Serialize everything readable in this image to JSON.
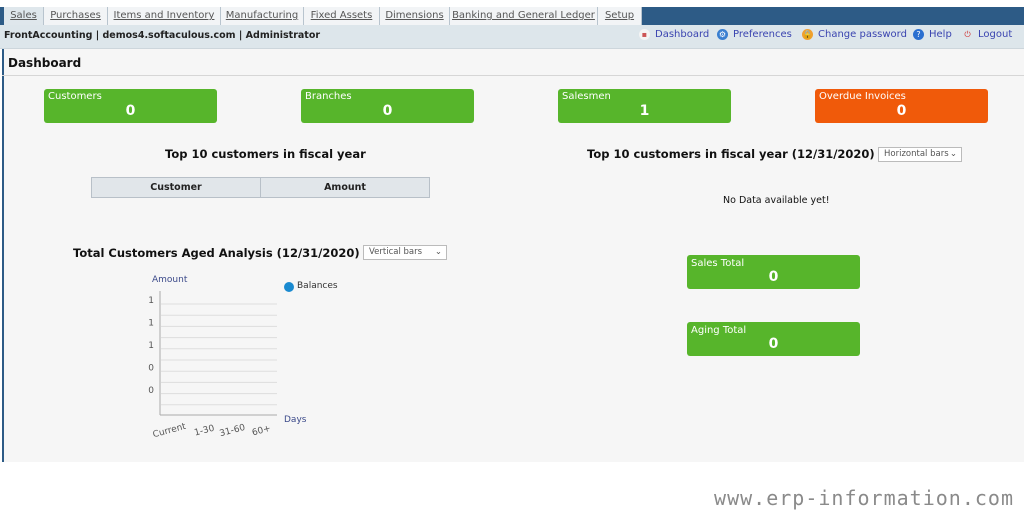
{
  "tabs": [
    "Sales",
    "Purchases",
    "Items and Inventory",
    "Manufacturing",
    "Fixed Assets",
    "Dimensions",
    "Banking and General Ledger",
    "Setup"
  ],
  "header": {
    "brand": "FrontAccounting | demos4.softaculous.com | Administrator",
    "links": [
      {
        "label": "Dashboard",
        "icon": "dashboard-icon"
      },
      {
        "label": "Preferences",
        "icon": "gear-icon"
      },
      {
        "label": "Change password",
        "icon": "lock-icon"
      },
      {
        "label": "Help",
        "icon": "help-icon"
      },
      {
        "label": "Logout",
        "icon": "power-icon"
      }
    ]
  },
  "page_title": "Dashboard",
  "cards": [
    {
      "label": "Customers",
      "value": "0"
    },
    {
      "label": "Branches",
      "value": "0"
    },
    {
      "label": "Salesmen",
      "value": "1"
    },
    {
      "label": "Overdue Invoices",
      "value": "0"
    }
  ],
  "top10_left": {
    "title": "Top 10 customers in fiscal year",
    "columns": [
      "Customer",
      "Amount"
    ]
  },
  "top10_right": {
    "title": "Top 10 customers in fiscal year (12/31/2020)",
    "select": "Horizontal bars",
    "empty": "No Data available yet!"
  },
  "aged": {
    "title": "Total Customers Aged Analysis (12/31/2020)",
    "select": "Vertical bars"
  },
  "totals": [
    {
      "label": "Sales Total",
      "value": "0"
    },
    {
      "label": "Aging Total",
      "value": "0"
    }
  ],
  "colors": {
    "green": "#57b52b",
    "orange": "#f05a0a",
    "nav_blue": "#2d5b86",
    "legend": "#1a8ad0"
  },
  "chart_data": {
    "type": "bar",
    "ylabel": "Amount",
    "xlabel": "Days",
    "categories": [
      "Current",
      "1-30",
      "31-60",
      "60+"
    ],
    "yticks": [
      "1",
      "1",
      "1",
      "0",
      "0"
    ],
    "series": [
      {
        "name": "Balances",
        "values": []
      }
    ],
    "grid": true,
    "legend": "top-right"
  },
  "watermark": "www.erp-information.com"
}
